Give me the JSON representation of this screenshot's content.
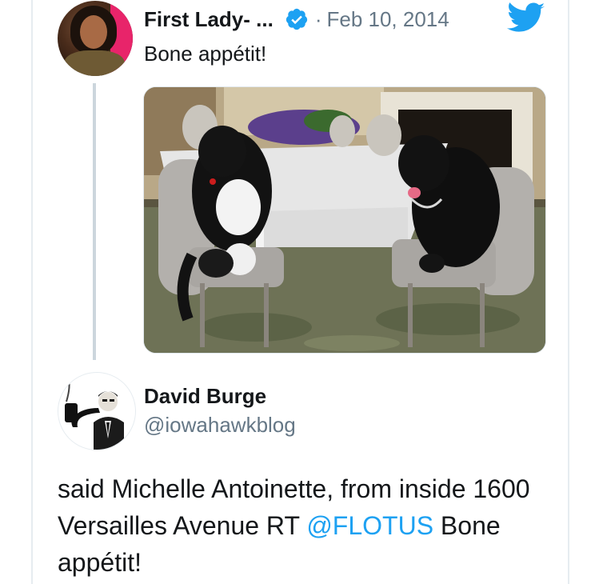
{
  "quoted_tweet": {
    "author_name": "First Lady- ...",
    "verified": true,
    "separator": "·",
    "date": "Feb 10, 2014",
    "text": "Bone appétit!",
    "brand_icon": "twitter-bird-icon",
    "accent_color": "#1da1f2"
  },
  "main_tweet": {
    "author_name": "David Burge",
    "handle": "@iowahawkblog",
    "text_before": "said Michelle Antoinette, from inside 1600 Versailles Avenue RT ",
    "mention": "@FLOTUS",
    "text_after": " Bone appétit!"
  },
  "colors": {
    "text": "#14171a",
    "secondary": "#657786",
    "link": "#1da1f2",
    "border": "#e6ecf0"
  }
}
